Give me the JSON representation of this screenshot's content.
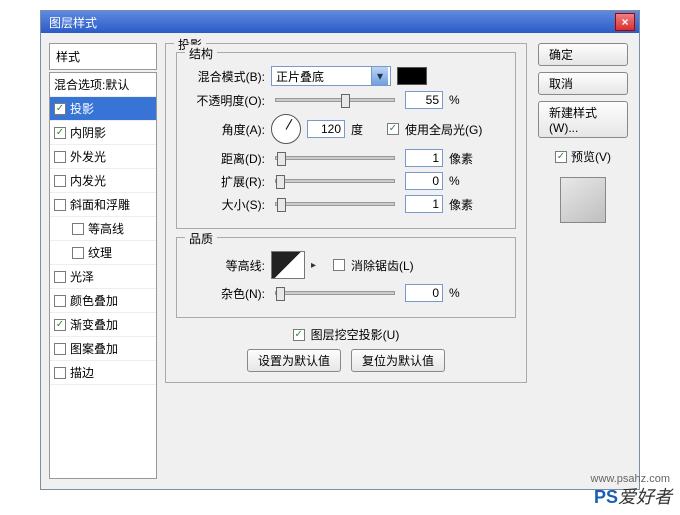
{
  "window": {
    "title": "图层样式",
    "close": "×"
  },
  "styles": {
    "header": "样式",
    "items": [
      {
        "label": "混合选项:默认",
        "checked": null,
        "indent": 0
      },
      {
        "label": "投影",
        "checked": true,
        "selected": true,
        "indent": 0
      },
      {
        "label": "内阴影",
        "checked": true,
        "indent": 0
      },
      {
        "label": "外发光",
        "checked": false,
        "indent": 0
      },
      {
        "label": "内发光",
        "checked": false,
        "indent": 0
      },
      {
        "label": "斜面和浮雕",
        "checked": false,
        "indent": 0
      },
      {
        "label": "等高线",
        "checked": false,
        "indent": 1
      },
      {
        "label": "纹理",
        "checked": false,
        "indent": 1
      },
      {
        "label": "光泽",
        "checked": false,
        "indent": 0
      },
      {
        "label": "颜色叠加",
        "checked": false,
        "indent": 0
      },
      {
        "label": "渐变叠加",
        "checked": true,
        "indent": 0
      },
      {
        "label": "图案叠加",
        "checked": false,
        "indent": 0
      },
      {
        "label": "描边",
        "checked": false,
        "indent": 0
      }
    ]
  },
  "panel": {
    "title": "投影",
    "structure": {
      "legend": "结构",
      "blendMode": {
        "label": "混合模式(B):",
        "value": "正片叠底",
        "color": "#000000"
      },
      "opacity": {
        "label": "不透明度(O):",
        "value": "55",
        "unit": "%",
        "pos": 55
      },
      "angle": {
        "label": "角度(A):",
        "value": "120",
        "unit": "度",
        "globalLabel": "使用全局光(G)",
        "globalChecked": true
      },
      "distance": {
        "label": "距离(D):",
        "value": "1",
        "unit": "像素",
        "pos": 1
      },
      "spread": {
        "label": "扩展(R):",
        "value": "0",
        "unit": "%",
        "pos": 0
      },
      "size": {
        "label": "大小(S):",
        "value": "1",
        "unit": "像素",
        "pos": 1
      }
    },
    "quality": {
      "legend": "品质",
      "contourLabel": "等高线:",
      "antiAlias": {
        "label": "消除锯齿(L)",
        "checked": false
      },
      "noise": {
        "label": "杂色(N):",
        "value": "0",
        "unit": "%",
        "pos": 0
      }
    },
    "knockout": {
      "label": "图层挖空投影(U)",
      "checked": true
    },
    "buttons": {
      "default": "设置为默认值",
      "reset": "复位为默认值"
    }
  },
  "right": {
    "ok": "确定",
    "cancel": "取消",
    "newStyle": "新建样式(W)...",
    "preview": "预览(V)"
  },
  "watermark": {
    "url": "www.psahz.com",
    "brand1": "PS",
    "brand2": "爱好者"
  }
}
